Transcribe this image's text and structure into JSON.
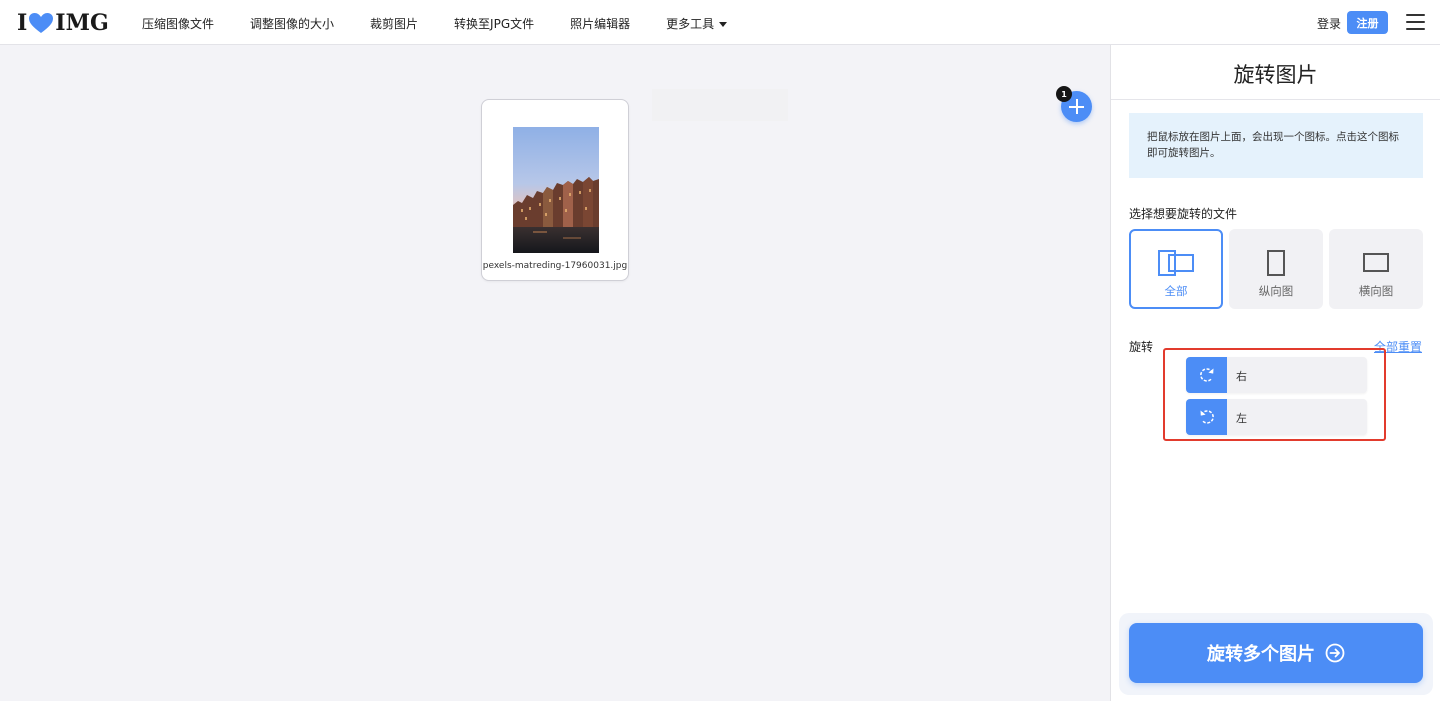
{
  "header": {
    "logo_left": "I",
    "logo_right": "IMG",
    "nav": [
      "压缩图像文件",
      "调整图像的大小",
      "裁剪图片",
      "转换至JPG文件",
      "照片编辑器"
    ],
    "more_tools": "更多工具",
    "login": "登录",
    "signup": "注册"
  },
  "workspace": {
    "file_name": "pexels-matreding-17960031.jpg",
    "file_count": "1"
  },
  "sidebar": {
    "title": "旋转图片",
    "info": "把鼠标放在图片上面，会出现一个图标。点击这个图标即可旋转图片。",
    "select_label": "选择想要旋转的文件",
    "options": [
      "全部",
      "纵向图",
      "横向图"
    ],
    "rotate_label": "旋转",
    "reset_all": "全部重置",
    "rotate_right": "右",
    "rotate_left": "左",
    "submit": "旋转多个图片"
  },
  "colors": {
    "accent": "#4c8df6",
    "highlight": "#e23b2d",
    "info_bg": "#e5f2fc"
  }
}
